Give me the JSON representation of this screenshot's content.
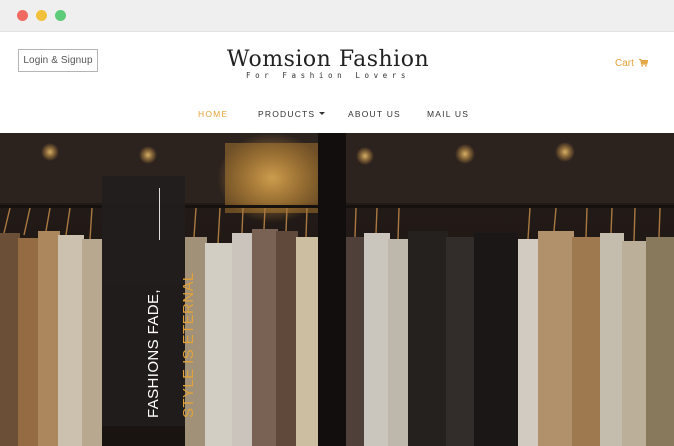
{
  "window": {
    "controls": [
      "close",
      "minimize",
      "maximize"
    ]
  },
  "header": {
    "login_label": "Login & Signup",
    "brand_name": "Womsion Fashion",
    "brand_tagline": "For Fashion Lovers",
    "cart_label": "Cart",
    "cart_icon": "shopping-cart-icon"
  },
  "nav": {
    "items": [
      {
        "label": "HOME",
        "active": true
      },
      {
        "label": "PRODUCTS",
        "has_dropdown": true
      },
      {
        "label": "ABOUT US"
      },
      {
        "label": "MAIL US"
      }
    ]
  },
  "hero": {
    "quote_line1": "FASHIONS FADE,",
    "quote_line2": "STYLE IS ETERNAL"
  },
  "colors": {
    "accent": "#e1a23a",
    "text_dark": "#222222",
    "panel": "#211e1e"
  }
}
